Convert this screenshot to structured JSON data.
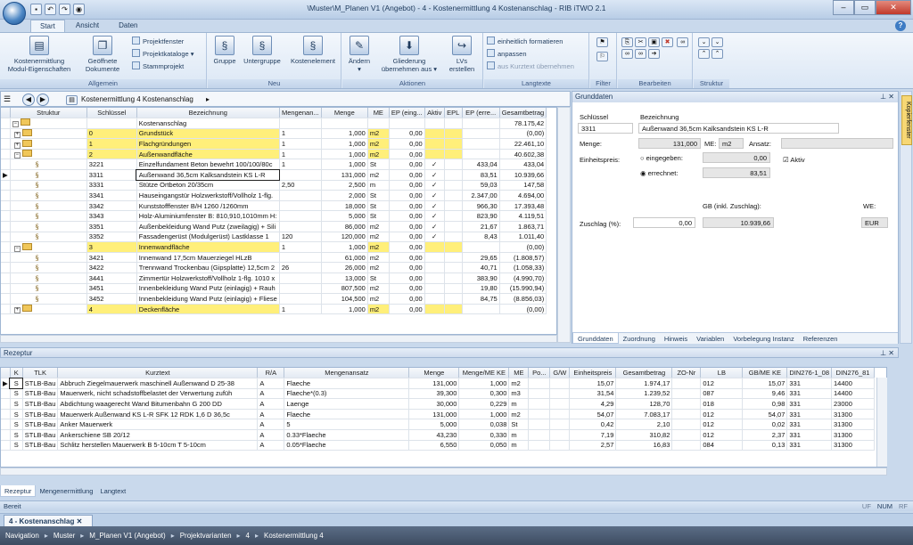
{
  "window": {
    "title": "\\Muster\\M_Planen V1 (Angebot) - 4 - Kostenermittlung 4 Kostenanschlag - RIB iTWO 2.1",
    "min": "–",
    "max": "▭",
    "close": "✕"
  },
  "ribbon_tabs": [
    "Start",
    "Ansicht",
    "Daten"
  ],
  "help": "?",
  "ribbon": {
    "groups": {
      "allgemein": "Allgemein",
      "neu": "Neu",
      "aktionen": "Aktionen",
      "langtexte": "Langtexte",
      "filter": "Filter",
      "bearbeiten": "Bearbeiten",
      "struktur": "Struktur"
    },
    "btn_kostenermittlung": "Kostenermittlung Modul-Eigenschaften",
    "btn_geoeffnete": "Geöffnete Dokumente",
    "btn_projektfenster": "Projektfenster",
    "btn_projektkataloge": "Projektkataloge",
    "btn_stammprojekt": "Stammprojekt",
    "btn_gruppe": "Gruppe",
    "btn_untergruppe": "Untergruppe",
    "btn_kostenelement": "Kostenelement",
    "btn_aendern": "Ändern",
    "btn_gliederung": "Gliederung übernehmen aus",
    "btn_lvs": "LVs erstellen",
    "btn_formatieren": "einheitlich formatieren",
    "btn_anpassen": "anpassen",
    "btn_kurztext": "aus Kurztext übernehmen"
  },
  "nav": {
    "path": "Kostenermittlung 4 Kostenanschlag"
  },
  "grid_headers": [
    "Struktur",
    "Schlüssel",
    "Bezeichnung",
    "Mengenan...",
    "Menge",
    "ME",
    "EP (eing...",
    "Aktiv",
    "EPL",
    "EP (erre...",
    "Gesamtbetrag"
  ],
  "grid_rows": [
    {
      "k": "",
      "b": "Kostenanschlag",
      "ma": "",
      "m": "",
      "me": "",
      "epe": "",
      "a": "",
      "ep": "",
      "g": "78.175,42",
      "t": "root"
    },
    {
      "k": "0",
      "b": "Grundstück",
      "ma": "1",
      "m": "1,000",
      "me": "m2",
      "epe": "0,00",
      "a": "",
      "ep": "",
      "g": "(0,00)",
      "t": "grp"
    },
    {
      "k": "1",
      "b": "Flachgründungen",
      "ma": "1",
      "m": "1,000",
      "me": "m2",
      "epe": "0,00",
      "a": "",
      "ep": "",
      "g": "22.461,10",
      "t": "grp"
    },
    {
      "k": "2",
      "b": "Außenwandfläche",
      "ma": "1",
      "m": "1,000",
      "me": "m2",
      "epe": "0,00",
      "a": "",
      "ep": "",
      "g": "40.602,38",
      "t": "grp"
    },
    {
      "k": "3221",
      "b": "Einzelfundament Beton bewehrt 100/100/80c",
      "ma": "1",
      "m": "1,000",
      "me": "St",
      "epe": "0,00",
      "a": "✓",
      "ep": "433,04",
      "g": "433,04",
      "t": "el"
    },
    {
      "k": "3311",
      "b": "Außenwand 36,5cm Kalksandstein KS L-R",
      "ma": "",
      "m": "131,000",
      "me": "m2",
      "epe": "0,00",
      "a": "✓",
      "ep": "83,51",
      "g": "10.939,66",
      "t": "sel"
    },
    {
      "k": "3331",
      "b": "Stütze Ortbeton 20/35cm",
      "ma": "2,50",
      "m": "2,500",
      "me": "m",
      "epe": "0,00",
      "a": "✓",
      "ep": "59,03",
      "g": "147,58",
      "t": "el"
    },
    {
      "k": "3341",
      "b": "Hauseingangstür Holzwerkstoff/Vollholz 1-flg.",
      "ma": "",
      "m": "2,000",
      "me": "St",
      "epe": "0,00",
      "a": "✓",
      "ep": "2.347,00",
      "g": "4.694,00",
      "t": "el"
    },
    {
      "k": "3342",
      "b": "Kunststofffenster B/H 1260 /1260mm",
      "ma": "",
      "m": "18,000",
      "me": "St",
      "epe": "0,00",
      "a": "✓",
      "ep": "966,30",
      "g": "17.393,48",
      "t": "el"
    },
    {
      "k": "3343",
      "b": "Holz-Aluminiumfenster B: 810,910,1010mm H:",
      "ma": "",
      "m": "5,000",
      "me": "St",
      "epe": "0,00",
      "a": "✓",
      "ep": "823,90",
      "g": "4.119,51",
      "t": "el"
    },
    {
      "k": "3351",
      "b": "Außenbekleidung Wand Putz (zweilagig) + Sili",
      "ma": "",
      "m": "86,000",
      "me": "m2",
      "epe": "0,00",
      "a": "✓",
      "ep": "21,67",
      "g": "1.863,71",
      "t": "el"
    },
    {
      "k": "3352",
      "b": "Fassadengerüst (Modulgerüst) Lastklasse 1",
      "ma": "120",
      "m": "120,000",
      "me": "m2",
      "epe": "0,00",
      "a": "✓",
      "ep": "8,43",
      "g": "1.011,40",
      "t": "el"
    },
    {
      "k": "3",
      "b": "Innenwandfläche",
      "ma": "1",
      "m": "1,000",
      "me": "m2",
      "epe": "0,00",
      "a": "",
      "ep": "",
      "g": "(0,00)",
      "t": "grp"
    },
    {
      "k": "3421",
      "b": "Innenwand 17,5cm Mauerziegel HLzB",
      "ma": "",
      "m": "61,000",
      "me": "m2",
      "epe": "0,00",
      "a": "",
      "ep": "29,65",
      "g": "(1.808,57)",
      "t": "el"
    },
    {
      "k": "3422",
      "b": "Trennwand Trockenbau (Gipsplatte) 12,5cm 2",
      "ma": "26",
      "m": "26,000",
      "me": "m2",
      "epe": "0,00",
      "a": "",
      "ep": "40,71",
      "g": "(1.058,33)",
      "t": "el"
    },
    {
      "k": "3441",
      "b": "Zimmertür Holzwerkstoff/Vollholz 1-flg. 1010 x",
      "ma": "",
      "m": "13,000",
      "me": "St",
      "epe": "0,00",
      "a": "",
      "ep": "383,90",
      "g": "(4.990,70)",
      "t": "el"
    },
    {
      "k": "3451",
      "b": "Innenbekleidung Wand Putz (einlagig) + Rauh",
      "ma": "",
      "m": "807,500",
      "me": "m2",
      "epe": "0,00",
      "a": "",
      "ep": "19,80",
      "g": "(15.990,94)",
      "t": "el"
    },
    {
      "k": "3452",
      "b": "Innenbekleidung Wand Putz (einlagig) + Fliese",
      "ma": "",
      "m": "104,500",
      "me": "m2",
      "epe": "0,00",
      "a": "",
      "ep": "84,75",
      "g": "(8.856,03)",
      "t": "el"
    },
    {
      "k": "4",
      "b": "Deckenfläche",
      "ma": "1",
      "m": "1,000",
      "me": "m2",
      "epe": "0,00",
      "a": "",
      "ep": "",
      "g": "(0,00)",
      "t": "grp"
    }
  ],
  "detail": {
    "header": "Grunddaten",
    "lbl_schluessel": "Schlüssel",
    "lbl_bezeichnung": "Bezeichnung",
    "schluessel": "3311",
    "bezeichnung": "Außenwand 36,5cm Kalksandstein KS L-R",
    "lbl_menge": "Menge:",
    "menge": "131,000",
    "lbl_me": "ME:",
    "me": "m2",
    "lbl_ansatz": "Ansatz:",
    "lbl_einheitspreis": "Einheitspreis:",
    "lbl_eingegeben": "eingegeben:",
    "eingegeben": "0,00",
    "lbl_errechnet": "errechnet:",
    "errechnet": "83,51",
    "lbl_aktiv": "Aktiv",
    "lbl_gb": "GB (inkl. Zuschlag):",
    "lbl_we": "WE:",
    "lbl_zuschlag": "Zuschlag (%):",
    "zuschlag": "0,00",
    "gb": "10.939,66",
    "we": "EUR",
    "tabs": [
      "Grunddaten",
      "Zuordnung",
      "Hinweis",
      "Variablen",
      "Vorbelegung Instanz",
      "Referenzen"
    ],
    "sidetab": "Kopierfenster"
  },
  "rezeptur": {
    "title": "Rezeptur",
    "headers": [
      "K",
      "TLK",
      "Kurztext",
      "R/A",
      "Mengenansatz",
      "Menge",
      "Menge/ME KE",
      "ME",
      "Po...",
      "G/W",
      "Einheitspreis",
      "Gesamtbetrag",
      "ZO-Nr",
      "LB",
      "GB/ME KE",
      "DIN276-1_08",
      "DIN276_81"
    ],
    "rows": [
      {
        "k": "S",
        "tlk": "STLB-Bau",
        "kt": "Abbruch Ziegelmauerwerk maschinell Außenwand D 25-38",
        "ra": "A",
        "ma": "Flaeche",
        "m": "131,000",
        "mk": "1,000",
        "me": "m2",
        "ep": "15,07",
        "gb": "1.974,17",
        "lb": "012",
        "gk": "15,07",
        "d1": "331",
        "d2": "14400"
      },
      {
        "k": "S",
        "tlk": "STLB-Bau",
        "kt": "Mauerwerk, nicht schadstoffbelastet der Verwertung zufüh",
        "ra": "A",
        "ma": "Flaeche*(0.3)",
        "m": "39,300",
        "mk": "0,300",
        "me": "m3",
        "ep": "31,54",
        "gb": "1.239,52",
        "lb": "087",
        "gk": "9,46",
        "d1": "331",
        "d2": "14400"
      },
      {
        "k": "S",
        "tlk": "STLB-Bau",
        "kt": "Abdichtung waagerecht Wand Bitumenbahn G 200 DD",
        "ra": "A",
        "ma": "Laenge",
        "m": "30,000",
        "mk": "0,229",
        "me": "m",
        "ep": "4,29",
        "gb": "128,70",
        "lb": "018",
        "gk": "0,98",
        "d1": "331",
        "d2": "23000"
      },
      {
        "k": "S",
        "tlk": "STLB-Bau",
        "kt": "Mauerwerk Außenwand KS L-R SFK 12 RDK 1,6 D 36,5c",
        "ra": "A",
        "ma": "Flaeche",
        "m": "131,000",
        "mk": "1,000",
        "me": "m2",
        "ep": "54,07",
        "gb": "7.083,17",
        "lb": "012",
        "gk": "54,07",
        "d1": "331",
        "d2": "31300"
      },
      {
        "k": "S",
        "tlk": "STLB-Bau",
        "kt": "Anker Mauerwerk",
        "ra": "A",
        "ma": "5",
        "m": "5,000",
        "mk": "0,038",
        "me": "St",
        "ep": "0,42",
        "gb": "2,10",
        "lb": "012",
        "gk": "0,02",
        "d1": "331",
        "d2": "31300"
      },
      {
        "k": "S",
        "tlk": "STLB-Bau",
        "kt": "Ankerschiene SB 20/12",
        "ra": "A",
        "ma": "0.33*Flaeche",
        "m": "43,230",
        "mk": "0,330",
        "me": "m",
        "ep": "7,19",
        "gb": "310,82",
        "lb": "012",
        "gk": "2,37",
        "d1": "331",
        "d2": "31300"
      },
      {
        "k": "S",
        "tlk": "STLB-Bau",
        "kt": "Schlitz herstellen Mauerwerk B 5-10cm T 5-10cm",
        "ra": "A",
        "ma": "0.05*Flaeche",
        "m": "6,550",
        "mk": "0,050",
        "me": "m",
        "ep": "2,57",
        "gb": "16,83",
        "lb": "084",
        "gk": "0,13",
        "d1": "331",
        "d2": "31300"
      }
    ],
    "tabs": [
      "Rezeptur",
      "Mengenermittlung",
      "Langtext"
    ]
  },
  "status": {
    "text": "Bereit",
    "indicators": [
      "UF",
      "NUM",
      "RF"
    ]
  },
  "doctab": "4 - Kostenanschlag",
  "breadcrumb": [
    "Navigation",
    "Muster",
    "M_Planen V1 (Angebot)",
    "Projektvarianten",
    "4",
    "Kostenermittlung 4"
  ],
  "colors": {
    "group_row": "#ffef7a",
    "accent": "#3e7cc4",
    "nav_footer": "#4a5a70"
  }
}
